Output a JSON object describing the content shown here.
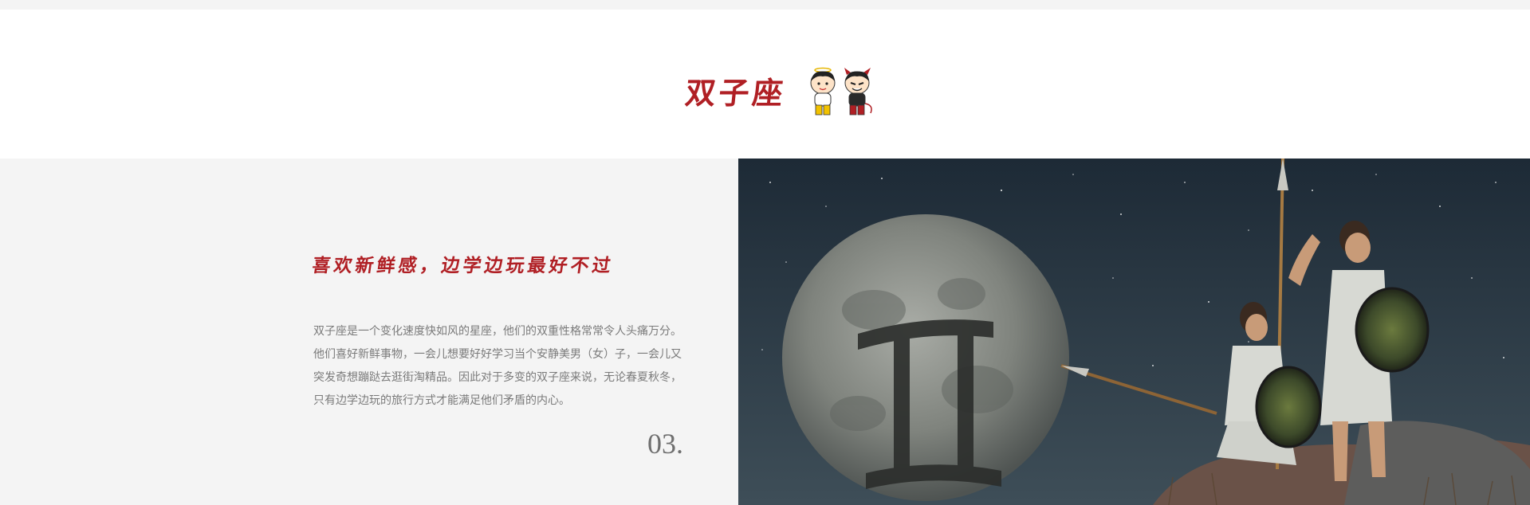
{
  "header": {
    "title": "双子座",
    "mascot_icon": "twin-boys-mascot-icon"
  },
  "content": {
    "subtitle": "喜欢新鲜感，边学边玩最好不过",
    "description": "双子座是一个变化速度快如风的星座，他们的双重性格常常令人头痛万分。他们喜好新鲜事物，一会儿想要好好学习当个安静美男（女）子，一会儿又突发奇想蹦跶去逛街淘精品。因此对于多变的双子座来说，无论春夏秋冬，只有边学边玩的旅行方式才能满足他们矛盾的内心。",
    "number": "03."
  },
  "hero": {
    "icon": "gemini-moon-warriors-illustration"
  },
  "colors": {
    "accent": "#b01f24",
    "panel_bg": "#f4f4f4",
    "body_text": "#7a7a7a",
    "number_text": "#6f6f6f"
  }
}
